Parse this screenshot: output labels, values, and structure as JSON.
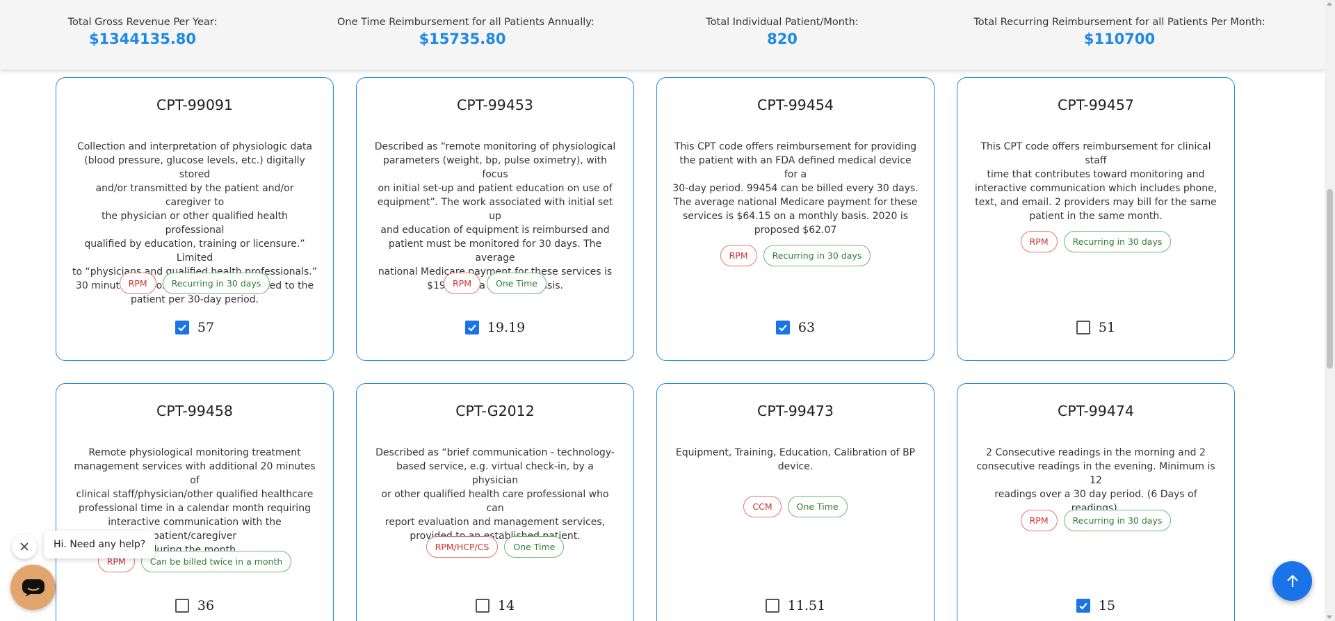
{
  "summary": {
    "gross_revenue_label": "Total Gross Revenue Per Year:",
    "gross_revenue_value": "$1344135.80",
    "one_time_label": "One Time Reimbursement for all Patients Annually:",
    "one_time_value": "$15735.80",
    "patient_month_label": "Total Individual Patient/Month:",
    "patient_month_value": "820",
    "recurring_label": "Total Recurring Reimbursement for all Patients Per Month:",
    "recurring_value": "$110700"
  },
  "colors": {
    "accent": "#1e88e5",
    "checkbox": "#1a73e8",
    "chip_red": "#d32f2f",
    "chip_green": "#2e7d32",
    "chat_launcher": "#e3a56e"
  },
  "cards": [
    {
      "title": "CPT-99091",
      "desc": [
        "Collection and interpretation of physiologic data",
        "(blood pressure, glucose levels, etc.) digitally stored",
        "and/or transmitted by the patient and/or caregiver to",
        "the physician or other qualified health professional",
        "qualified by education, training or licensure.” Limited",
        "to “physicians and qualified health professionals.”",
        "30 minutes of professional time dedicated to the",
        "patient per 30-day period."
      ],
      "chips": [
        {
          "label": "RPM",
          "tone": "red"
        },
        {
          "label": "Recurring in 30 days",
          "tone": "green"
        }
      ],
      "checked": true,
      "amount": "57"
    },
    {
      "title": "CPT-99453",
      "desc": [
        "Described as “remote monitoring of physiological",
        "parameters (weight, bp, pulse oximetry), with focus",
        "on initial set-up and patient education on use of",
        "equipment”. The work associated with initial set up",
        "and education of equipment is reimbursed and",
        "patient must be monitored for 30 days. The average",
        "national Medicare payment for these services is",
        "$19.19 on a one-time basis."
      ],
      "chips": [
        {
          "label": "RPM",
          "tone": "red"
        },
        {
          "label": "One Time",
          "tone": "green"
        }
      ],
      "checked": true,
      "amount": "19.19"
    },
    {
      "title": "CPT-99454",
      "desc": [
        "This CPT code offers reimbursement for providing",
        "the patient with an FDA defined medical device for a",
        "30-day period. 99454 can be billed every 30 days.",
        "The average national Medicare payment for these",
        "services is $64.15 on a monthly basis. 2020 is",
        "proposed $62.07"
      ],
      "chips": [
        {
          "label": "RPM",
          "tone": "red"
        },
        {
          "label": "Recurring in 30 days",
          "tone": "green"
        }
      ],
      "checked": true,
      "amount": "63"
    },
    {
      "title": "CPT-99457",
      "desc": [
        "This CPT code offers reimbursement for clinical staff",
        "time that contributes toward monitoring and",
        "interactive communication which includes phone,",
        "text, and email. 2 providers may bill for the same",
        "patient in the same month."
      ],
      "chips": [
        {
          "label": "RPM",
          "tone": "red"
        },
        {
          "label": "Recurring in 30 days",
          "tone": "green"
        }
      ],
      "checked": false,
      "amount": "51"
    },
    {
      "title": "CPT-99458",
      "desc": [
        "Remote physiological monitoring treatment",
        "management services with additional 20 minutes of",
        "clinical staff/physician/other qualified healthcare",
        "professional time in a calendar month requiring",
        "interactive communication with the patient/caregiver",
        "during the month."
      ],
      "chips": [
        {
          "label": "RPM",
          "tone": "red"
        },
        {
          "label": "Can be billed twice in a month",
          "tone": "green"
        }
      ],
      "checked": false,
      "amount": "36"
    },
    {
      "title": "CPT-G2012",
      "desc": [
        "Described as “brief communication - technology-",
        "based service, e.g. virtual check-in, by a physician",
        "or other qualified health care professional who can",
        "report evaluation and management services,",
        "provided to an established patient."
      ],
      "chips": [
        {
          "label": "RPM/HCP/CS",
          "tone": "red"
        },
        {
          "label": "One Time",
          "tone": "green"
        }
      ],
      "checked": false,
      "amount": "14"
    },
    {
      "title": "CPT-99473",
      "desc": [
        "Equipment, Training, Education, Calibration of BP",
        "device."
      ],
      "chips": [
        {
          "label": "CCM",
          "tone": "red"
        },
        {
          "label": "One Time",
          "tone": "green"
        }
      ],
      "checked": false,
      "amount": "11.51"
    },
    {
      "title": "CPT-99474",
      "desc": [
        "2 Consecutive readings in the morning and 2",
        "consecutive readings in the evening. Minimum is 12",
        "readings over a 30 day period. (6 Days of readings)."
      ],
      "chips": [
        {
          "label": "RPM",
          "tone": "red"
        },
        {
          "label": "Recurring in 30 days",
          "tone": "green"
        }
      ],
      "checked": true,
      "amount": "15"
    }
  ],
  "chat": {
    "greeting": "Hi. Need any help?"
  }
}
